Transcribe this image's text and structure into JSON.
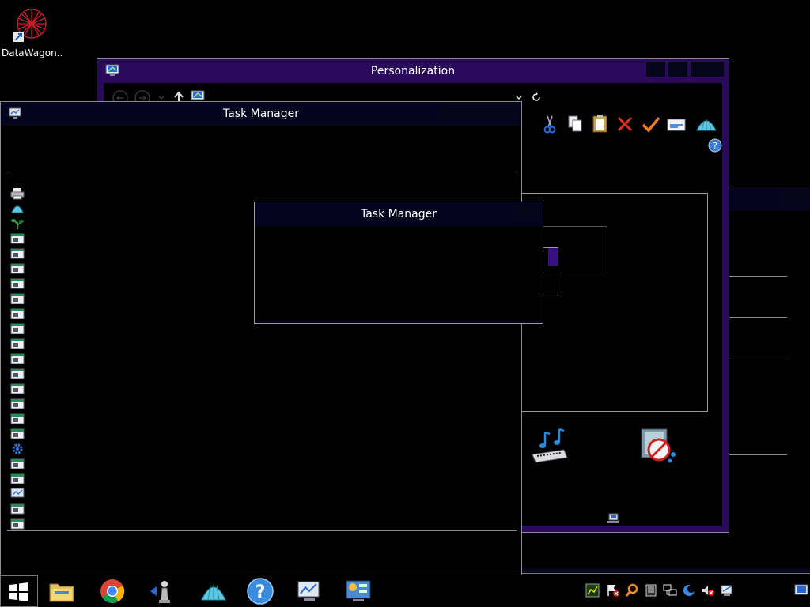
{
  "desktop": {
    "icons": [
      {
        "label": "DataWagon...",
        "icon": "datawagon-shortcut-icon"
      }
    ]
  },
  "personalization": {
    "title": "Personalization"
  },
  "task_manager": {
    "title": "Task Manager"
  },
  "task_manager_dialog": {
    "title": "Task Manager"
  },
  "colors": {
    "accent_purple": "#2a0a5a",
    "title_band": "#04041e",
    "border_gray": "#8a8a8a"
  }
}
